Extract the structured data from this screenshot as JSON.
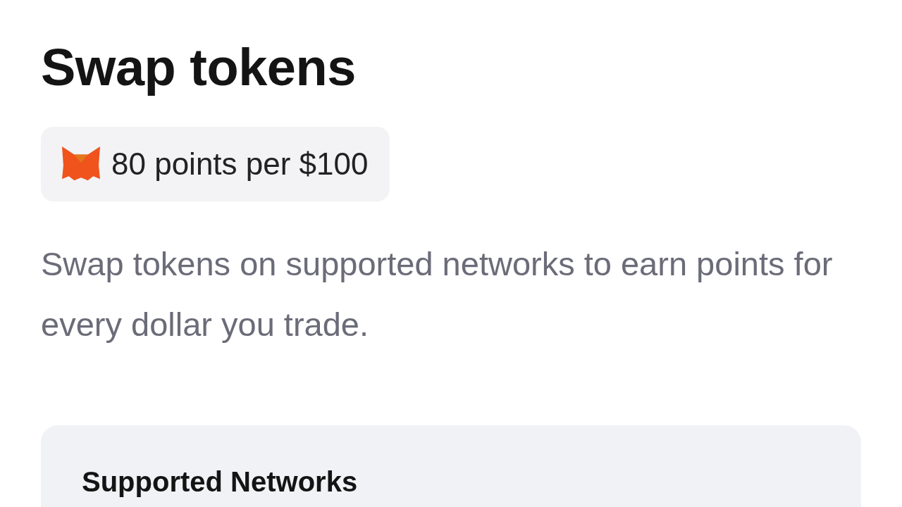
{
  "title": "Swap tokens",
  "badge": {
    "text": "80 points per $100"
  },
  "description": "Swap tokens on supported networks to earn points for every dollar you trade.",
  "networks_card": {
    "heading": "Supported Networks"
  }
}
